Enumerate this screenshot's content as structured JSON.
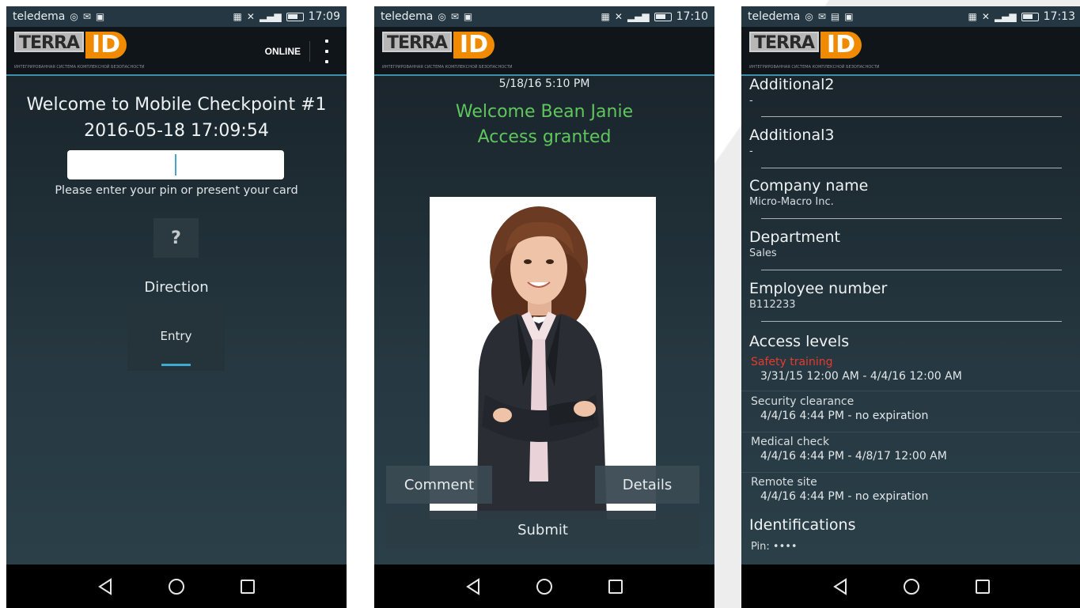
{
  "status_bar": {
    "carrier": "teledema",
    "phone1_time": "17:09",
    "phone2_time": "17:10",
    "phone3_time": "17:13"
  },
  "logo": {
    "terra": "TERRA",
    "id": "ID",
    "tagline": "ИНТЕГРИРОВАННАЯ СИСТЕМА КОМПЛЕКСНОЙ БЕЗОПАСНОСТИ"
  },
  "phone1": {
    "online_label": "ONLINE",
    "welcome": "Welcome to Mobile Checkpoint #1",
    "datetime": "2016-05-18 17:09:54",
    "pin_input_value": "",
    "hint": "Please enter your pin or present your card",
    "unknown_button": "?",
    "direction_label": "Direction",
    "direction_tab": "Entry"
  },
  "phone2": {
    "timestamp": "5/18/16 5:10 PM",
    "welcome": "Welcome Bean Janie",
    "status": "Access granted",
    "comment_button": "Comment",
    "details_button": "Details",
    "submit_button": "Submit"
  },
  "phone3": {
    "fields": [
      {
        "label": "Additional2",
        "value": "-"
      },
      {
        "label": "Additional3",
        "value": "-"
      },
      {
        "label": "Company name",
        "value": "Micro-Macro Inc."
      },
      {
        "label": "Department",
        "value": "Sales"
      },
      {
        "label": "Employee number",
        "value": "B112233"
      }
    ],
    "access_levels_title": "Access levels",
    "access_levels": [
      {
        "name": "Safety training",
        "range": "3/31/15 12:00 AM - 4/4/16 12:00 AM",
        "expired": true
      },
      {
        "name": "Security clearance",
        "range": "4/4/16 4:44 PM - no expiration",
        "expired": false
      },
      {
        "name": "Medical check",
        "range": "4/4/16 4:44 PM - 4/8/17 12:00 AM",
        "expired": false
      },
      {
        "name": "Remote site",
        "range": "4/4/16 4:44 PM - no expiration",
        "expired": false
      }
    ],
    "identifications_title": "Identifications",
    "identification_value": "Pin: ••••"
  },
  "colors": {
    "granted_green": "#5fc65e",
    "expired_red": "#e63a2f",
    "accent_blue": "#3fa9cf",
    "logo_orange": "#f08a00"
  }
}
